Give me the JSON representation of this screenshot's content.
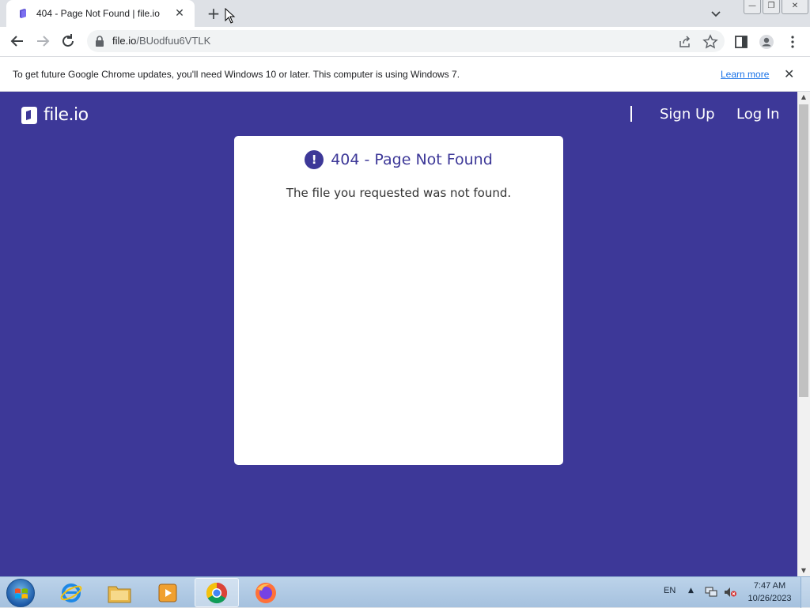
{
  "browser": {
    "tab_title": "404 - Page Not Found | file.io",
    "tab_close": "✕",
    "new_tab": "+",
    "url_host": "file.io",
    "url_path": "/BUodfuu6VTLK",
    "window_buttons": [
      "—",
      "❐",
      "✕"
    ]
  },
  "infobar": {
    "message": "To get future Google Chrome updates, you'll need Windows 10 or later. This computer is using Windows 7.",
    "link": "Learn more",
    "close": "✕"
  },
  "site": {
    "logo_text": "file.io",
    "nav": {
      "sign_up": "Sign Up",
      "log_in": "Log In"
    },
    "brand_color": "#3d3898"
  },
  "card": {
    "icon": "!",
    "title": "404 - Page Not Found",
    "message": "The file you requested was not found."
  },
  "taskbar": {
    "apps": [
      "internet-explorer-icon",
      "file-explorer-icon",
      "media-player-icon",
      "chrome-icon",
      "firefox-icon"
    ],
    "language": "EN",
    "time": "7:47 AM",
    "date": "10/26/2023"
  }
}
